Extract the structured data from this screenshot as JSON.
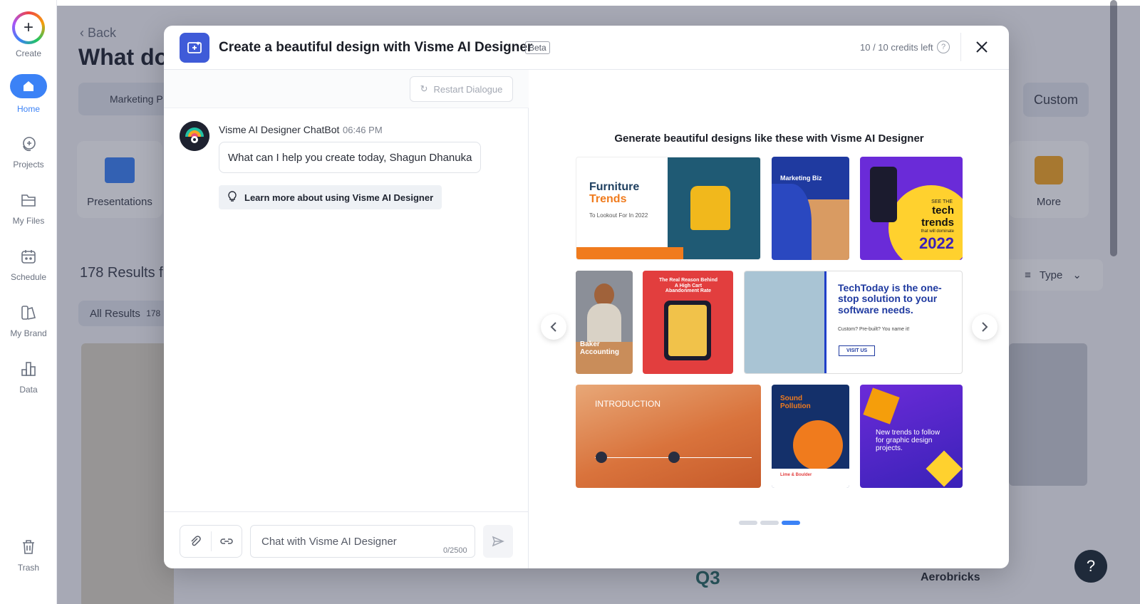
{
  "sidebar": {
    "items": [
      {
        "label": "Create",
        "icon": "plus-icon"
      },
      {
        "label": "Home",
        "icon": "home-icon"
      },
      {
        "label": "Projects",
        "icon": "projects-icon"
      },
      {
        "label": "My Files",
        "icon": "folder-icon"
      },
      {
        "label": "Schedule",
        "icon": "calendar-icon"
      },
      {
        "label": "My Brand",
        "icon": "brand-icon"
      },
      {
        "label": "Data",
        "icon": "data-icon"
      },
      {
        "label": "Trash",
        "icon": "trash-icon"
      }
    ]
  },
  "background": {
    "back_label": "Back",
    "title": "What do",
    "search_value": "Marketing P",
    "custom_label": "Custom",
    "cards": [
      "Presentations",
      "More"
    ],
    "results_text": "178 Results f",
    "all_results_label": "All Results",
    "all_results_count": "178",
    "type_label": "Type",
    "aerobricks": "Aerobricks",
    "q3": "Q3"
  },
  "modal": {
    "title": "Create a beautiful design with Visme AI Designer",
    "beta": "Beta",
    "credits": "10 / 10 credits left",
    "restart_label": "Restart Dialogue",
    "bot_name": "Visme AI Designer ChatBot",
    "bot_time": "06:46 PM",
    "bot_message": "What can I help you create today, Shagun Dhanuka",
    "learn_more": "Learn more about using Visme AI Designer",
    "chat_placeholder": "Chat with Visme AI Designer",
    "char_count": "0/2500",
    "gallery_title": "Generate beautiful designs like these with Visme AI Designer",
    "carousel_page": 3,
    "carousel_pages": 3
  },
  "tiles": {
    "furniture_title": "Furniture",
    "furniture_sub": "Trends",
    "furniture_caption": "To Lookout For In 2022",
    "marketing": "Marketing Biz",
    "tech_see": "SEE THE",
    "tech_trends": "tech trends",
    "tech_dom": "that will dominate",
    "tech_year": "2022",
    "baker": "Baker Accounting",
    "cart": "The Real Reason Behind A High Cart Abandonment Rate",
    "techtoday": "TechToday is the one-stop solution to your software needs.",
    "techtoday_sub": "Custom? Pre-built? You name it!",
    "visit": "VISIT US",
    "intro": "INTRODUCTION",
    "sound": "Sound Pollution",
    "lime": "Lime & Boulder",
    "newtrends": "New trends to follow for graphic design projects."
  },
  "help": "?",
  "colors": {
    "accent": "#3b82f6",
    "modal_logo": "#3f5bd8"
  }
}
